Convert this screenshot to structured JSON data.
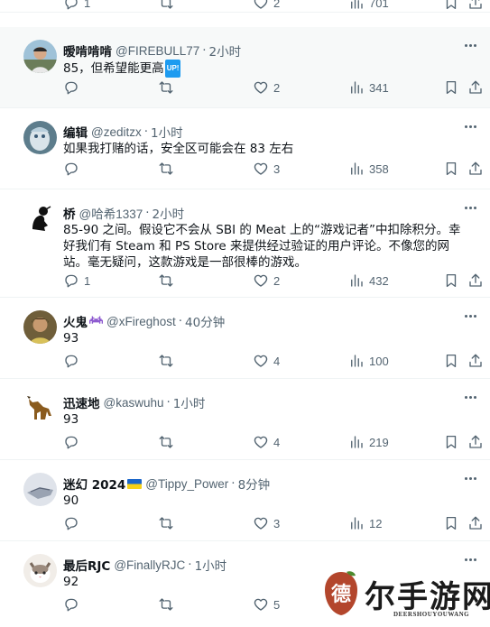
{
  "top_actions": {
    "reply": "1",
    "retweet": "",
    "like": "2",
    "views": "701"
  },
  "tweets": [
    {
      "name": "暧啃啃啃",
      "handle": "@FIREBULL77",
      "time": "2小时",
      "text": "85，但希望能更高",
      "badge": "UP!",
      "reply": "",
      "retweet": "",
      "like": "2",
      "views": "341",
      "highlight": true
    },
    {
      "name": "编辑",
      "handle": "@zeditzx",
      "time": "1小时",
      "text": "如果我打赌的话，安全区可能会在 83 左右",
      "reply": "",
      "retweet": "",
      "like": "3",
      "views": "358"
    },
    {
      "name": "桥",
      "handle": "@哈希1337",
      "time": "2小时",
      "text": "85-90 之间。假设它不会从 SBI 的 Meat 上的“游戏记者”中扣除积分。幸好我们有 Steam 和 PS Store 来提供经过验证的用户评论。不像您的网站。毫无疑问，这款游戏是一部很棒的游戏。",
      "reply": "1",
      "retweet": "",
      "like": "2",
      "views": "432"
    },
    {
      "name": "火鬼",
      "handle": "@xFireghost",
      "time": "40分钟",
      "text": "93",
      "reply": "",
      "retweet": "",
      "like": "4",
      "views": "100"
    },
    {
      "name": "迅速地",
      "handle": "@kaswuhu",
      "time": "1小时",
      "text": "93",
      "reply": "",
      "retweet": "",
      "like": "4",
      "views": "219"
    },
    {
      "name": "迷幻 2024",
      "handle": "@Tippy_Power",
      "time": "8分钟",
      "text": "90",
      "reply": "",
      "retweet": "",
      "like": "3",
      "views": "12"
    },
    {
      "name": "最后RJC",
      "handle": "@FinallyRJC",
      "time": "1小时",
      "text": "92",
      "reply": "",
      "retweet": "",
      "like": "5",
      "views": ""
    }
  ],
  "watermark": {
    "main": "尔手游网",
    "sub": "DEERSHOUYOUWANG",
    "seal": "德"
  },
  "colors": {
    "muted": "#536471",
    "text": "#0f1419",
    "border": "#eff3f4",
    "highlight_bg": "#f7f9f9",
    "accent": "#1d9bf0"
  }
}
